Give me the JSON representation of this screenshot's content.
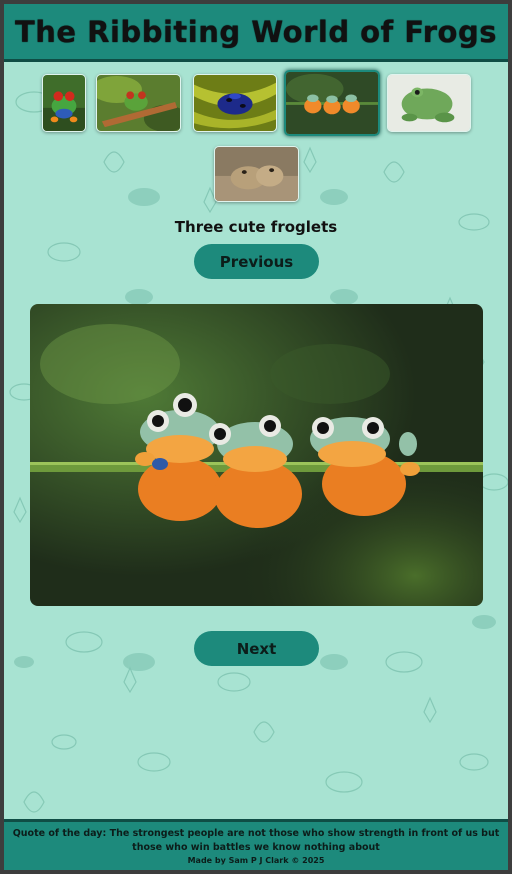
{
  "header": {
    "title": "The Ribbiting World of Frogs"
  },
  "gallery": {
    "thumbnails": [
      {
        "name": "red-eyed tree frog",
        "active": false
      },
      {
        "name": "frog on branch",
        "active": false
      },
      {
        "name": "blue poison dart frog",
        "active": false
      },
      {
        "name": "three froglets",
        "active": true
      },
      {
        "name": "green tree frog",
        "active": false
      },
      {
        "name": "brown rain frog",
        "active": false
      }
    ],
    "caption": "Three cute froglets",
    "previous_label": "Previous",
    "next_label": "Next"
  },
  "footer": {
    "quote": "Quote of the day: The strongest people are not those who show strength in front of us but those who win battles we know nothing about",
    "credit": "Made by Sam P J Clark © 2025"
  },
  "colors": {
    "page_bg": "#a8e3d2",
    "accent": "#1d8a7c",
    "accent_dark": "#0f4d45",
    "outer_bg": "#3d3d3d"
  }
}
